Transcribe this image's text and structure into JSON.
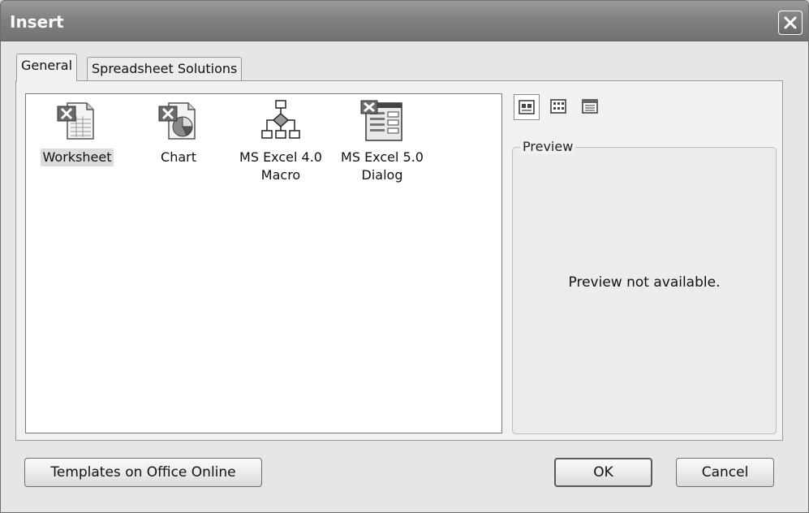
{
  "window": {
    "title": "Insert"
  },
  "tabs": [
    {
      "label": "General",
      "active": true
    },
    {
      "label": "Spreadsheet Solutions",
      "active": false
    }
  ],
  "items": [
    {
      "label": "Worksheet",
      "icon": "worksheet-icon",
      "selected": true
    },
    {
      "label": "Chart",
      "icon": "chart-sheet-icon",
      "selected": false
    },
    {
      "label_line1": "MS Excel 4.0",
      "label_line2": "Macro",
      "icon": "macro-icon",
      "selected": false
    },
    {
      "label_line1": "MS Excel 5.0",
      "label_line2": "Dialog",
      "icon": "dialog-sheet-icon",
      "selected": false
    }
  ],
  "view_buttons": [
    {
      "icon": "large-icons-view-icon",
      "active": true
    },
    {
      "icon": "list-view-icon",
      "active": false
    },
    {
      "icon": "details-view-icon",
      "active": false
    }
  ],
  "preview": {
    "legend": "Preview",
    "message": "Preview not available."
  },
  "buttons": {
    "templates": "Templates on Office Online",
    "ok": "OK",
    "cancel": "Cancel"
  }
}
